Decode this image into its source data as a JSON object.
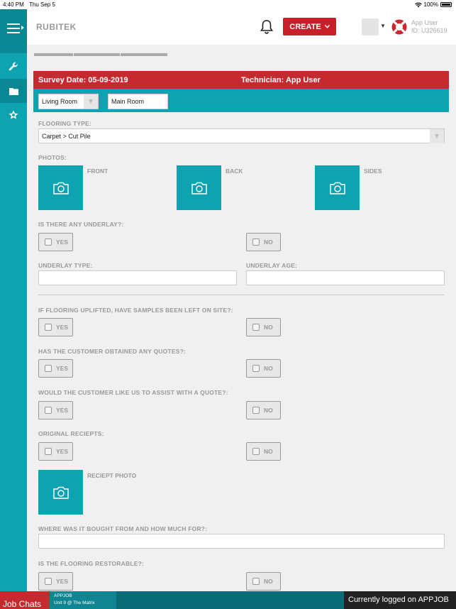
{
  "status_bar": {
    "time": "4:40 PM",
    "date": "Thu Sep 5",
    "battery": "100%"
  },
  "header": {
    "brand": "RUBITEK",
    "create_label": "CREATE",
    "user_name": "App User",
    "user_id": "ID: U326619"
  },
  "survey": {
    "date": "Survey Date: 05-09-2019",
    "technician": "Technician: App User"
  },
  "room": {
    "room_type": "Living Room",
    "room_name": "Main Room"
  },
  "form": {
    "flooring_type_label": "FLOORING TYPE:",
    "flooring_type_value": "Carpet > Cut Pile",
    "photos_label": "PHOTOS:",
    "photo_front": "FRONT",
    "photo_back": "BACK",
    "photo_sides": "SIDES",
    "underlay_q": "IS THERE ANY UNDERLAY?:",
    "underlay_type": "UNDERLAY TYPE:",
    "underlay_age": "UNDERLAY AGE:",
    "samples_q": "IF FLOORING UPLIFTED, HAVE SAMPLES BEEN LEFT ON SITE?:",
    "quotes_q": "HAS THE CUSTOMER OBTAINED ANY QUOTES?:",
    "assist_q": "WOULD THE CUSTOMER LIKE US TO ASSIST WITH A QUOTE?:",
    "receipts_q": "ORIGINAL RECIEPTS:",
    "receipt_photo": "RECIEPT PHOTO",
    "bought_q": "WHERE WAS IT BOUGHT FROM AND HOW MUCH FOR?:",
    "restorable_q": "IS THE FLOORING RESTORABLE?:",
    "yes": "YES",
    "no": "NO"
  },
  "footer": {
    "job_chats": "Job Chats",
    "job_code": "APPJOB",
    "job_location": "Unit 9 @ The Matrix",
    "logged_in": "Currently logged on APPJOB"
  },
  "colors": {
    "teal": "#0fa3b1",
    "red": "#c62a31"
  }
}
